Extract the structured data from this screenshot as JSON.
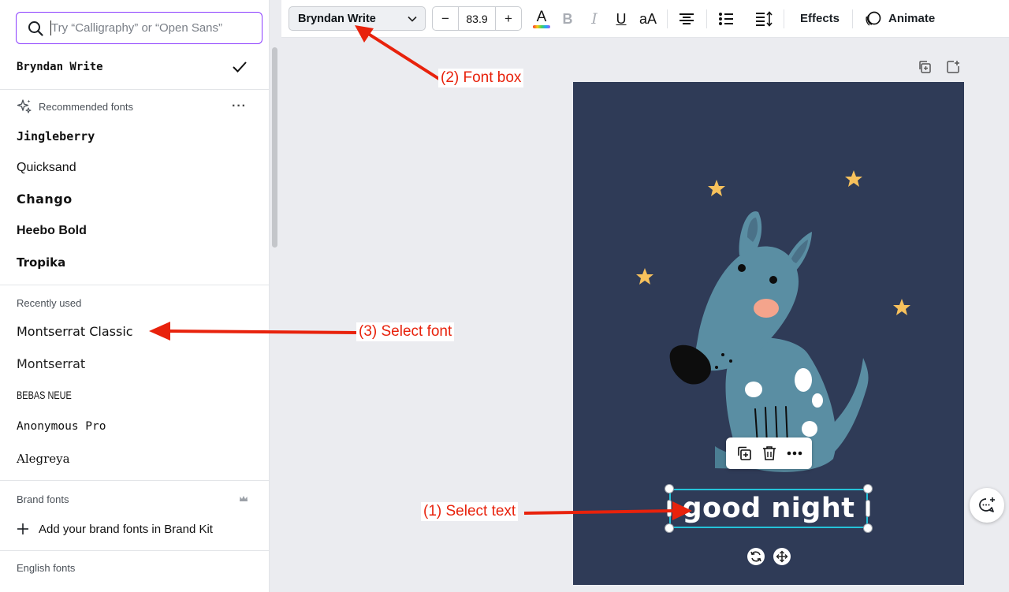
{
  "font_panel": {
    "search": {
      "placeholder": "Try “Calligraphy” or “Open Sans”",
      "value": ""
    },
    "current_font": "Bryndan Write",
    "recommended": {
      "label": "Recommended fonts",
      "items": [
        "Jingleberry",
        "Quicksand",
        "Chango",
        "Heebo Bold",
        "Tropika"
      ]
    },
    "recently_used": {
      "label": "Recently used",
      "items": [
        "Montserrat Classic",
        "Montserrat",
        "BEBAS NEUE",
        "Anonymous Pro",
        "Alegreya"
      ]
    },
    "brand": {
      "label": "Brand fonts",
      "add_label": "Add your brand fonts in Brand Kit"
    },
    "english_label": "English fonts"
  },
  "toolbar": {
    "font_name": "Bryndan Write",
    "font_size": "83.9",
    "minus_label": "−",
    "plus_label": "+",
    "text_color_glyph": "A",
    "bold_glyph": "B",
    "italic_glyph": "I",
    "underline_glyph": "U",
    "case_glyph": "aA",
    "effects_label": "Effects",
    "animate_label": "Animate"
  },
  "canvas": {
    "text": "good night",
    "background_color": "#2f3b57",
    "selection_color": "#25c2d8"
  },
  "annotations": {
    "select_text": "(1) Select text",
    "font_box": "(2) Font box",
    "select_font": "(3) Select font",
    "color": "#e8220c"
  }
}
